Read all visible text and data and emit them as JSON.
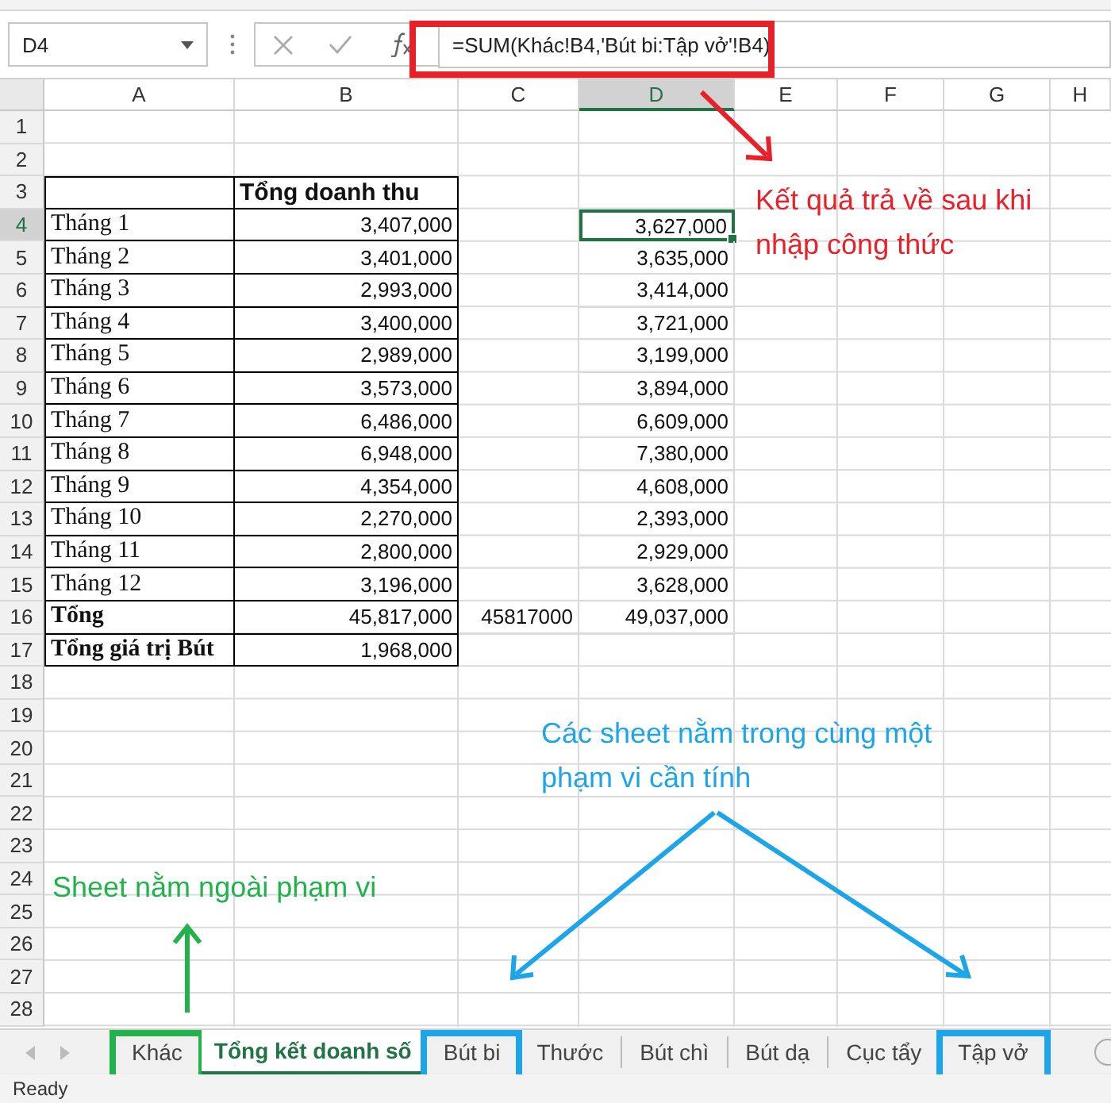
{
  "name_box": "D4",
  "formula": "=SUM(Khác!B4,'Bút bi:Tập vở'!B4)",
  "columns": [
    {
      "label": "A",
      "selected": false
    },
    {
      "label": "B",
      "selected": false
    },
    {
      "label": "C",
      "selected": false
    },
    {
      "label": "D",
      "selected": true
    },
    {
      "label": "E",
      "selected": false
    },
    {
      "label": "F",
      "selected": false
    },
    {
      "label": "G",
      "selected": false
    },
    {
      "label": "H",
      "selected": false
    }
  ],
  "rows": [
    {
      "number": "1",
      "kind": "blank",
      "selected": false
    },
    {
      "number": "2",
      "kind": "blank",
      "selected": false
    },
    {
      "number": "3",
      "kind": "table_header",
      "selected": false,
      "b": "Tổng doanh thu"
    },
    {
      "number": "4",
      "kind": "table_row",
      "selected": true,
      "a": "Tháng 1",
      "b": "3,407,000",
      "d": "3,627,000"
    },
    {
      "number": "5",
      "kind": "table_row",
      "selected": false,
      "a": "Tháng 2",
      "b": "3,401,000",
      "d": "3,635,000"
    },
    {
      "number": "6",
      "kind": "table_row",
      "selected": false,
      "a": "Tháng 3",
      "b": "2,993,000",
      "d": "3,414,000"
    },
    {
      "number": "7",
      "kind": "table_row",
      "selected": false,
      "a": "Tháng 4",
      "b": "3,400,000",
      "d": "3,721,000"
    },
    {
      "number": "8",
      "kind": "table_row",
      "selected": false,
      "a": "Tháng 5",
      "b": "2,989,000",
      "d": "3,199,000"
    },
    {
      "number": "9",
      "kind": "table_row",
      "selected": false,
      "a": "Tháng 6",
      "b": "3,573,000",
      "d": "3,894,000"
    },
    {
      "number": "10",
      "kind": "table_row",
      "selected": false,
      "a": "Tháng 7",
      "b": "6,486,000",
      "d": "6,609,000"
    },
    {
      "number": "11",
      "kind": "table_row",
      "selected": false,
      "a": "Tháng 8",
      "b": "6,948,000",
      "d": "7,380,000"
    },
    {
      "number": "12",
      "kind": "table_row",
      "selected": false,
      "a": "Tháng 9",
      "b": "4,354,000",
      "d": "4,608,000"
    },
    {
      "number": "13",
      "kind": "table_row",
      "selected": false,
      "a": "Tháng 10",
      "b": "2,270,000",
      "d": "2,393,000"
    },
    {
      "number": "14",
      "kind": "table_row",
      "selected": false,
      "a": "Tháng 11",
      "b": "2,800,000",
      "d": "2,929,000"
    },
    {
      "number": "15",
      "kind": "table_row",
      "selected": false,
      "a": "Tháng 12",
      "b": "3,196,000",
      "d": "3,628,000"
    },
    {
      "number": "16",
      "kind": "total_row",
      "selected": false,
      "a": "Tổng",
      "b": "45,817,000",
      "c": "45817000",
      "d": "49,037,000"
    },
    {
      "number": "17",
      "kind": "total_row",
      "selected": false,
      "a": "Tổng giá trị Bút",
      "b": "1,968,000"
    },
    {
      "number": "18",
      "kind": "blank",
      "selected": false
    },
    {
      "number": "19",
      "kind": "blank",
      "selected": false
    },
    {
      "number": "20",
      "kind": "blank",
      "selected": false
    },
    {
      "number": "21",
      "kind": "blank",
      "selected": false
    },
    {
      "number": "22",
      "kind": "blank",
      "selected": false
    },
    {
      "number": "23",
      "kind": "blank",
      "selected": false
    },
    {
      "number": "24",
      "kind": "blank",
      "selected": false
    },
    {
      "number": "25",
      "kind": "blank",
      "selected": false
    },
    {
      "number": "26",
      "kind": "blank",
      "selected": false
    },
    {
      "number": "27",
      "kind": "blank",
      "selected": false
    },
    {
      "number": "28",
      "kind": "blank",
      "selected": false
    }
  ],
  "sheet_tabs": [
    {
      "label": "Khác",
      "selected": false,
      "color": "#22b24c"
    },
    {
      "label": "Tổng kết doanh số",
      "selected": true
    },
    {
      "label": "Bút bi",
      "selected": false,
      "color": "#1ea5e8"
    },
    {
      "label": "Thước",
      "selected": false
    },
    {
      "label": "Bút chì",
      "selected": false
    },
    {
      "label": "Bút dạ",
      "selected": false
    },
    {
      "label": "Cục tẩy",
      "selected": false
    },
    {
      "label": "Tập vở",
      "selected": false,
      "color": "#1ea5e8"
    }
  ],
  "status_bar": {
    "text": "Ready"
  },
  "annotations": [
    {
      "text": "Kết quả trả về sau khi nhập công thức",
      "color": "#e8202a"
    },
    {
      "text": "Các sheet nằm trong cùng một phạm vi cần tính",
      "color": "#1ea5e8"
    },
    {
      "text": "Sheet nằm ngoài phạm vi",
      "color": "#22b24c"
    }
  ]
}
